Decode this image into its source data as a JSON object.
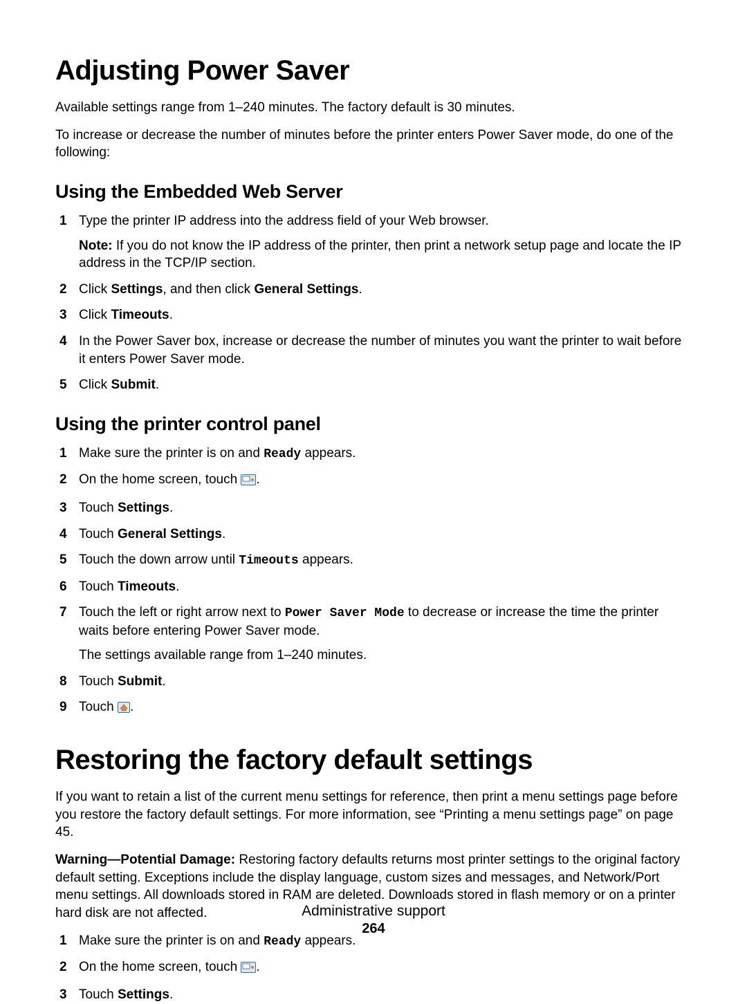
{
  "section1": {
    "title": "Adjusting Power Saver",
    "intro1": "Available settings range from 1–240 minutes. The factory default is 30 minutes.",
    "intro2": "To increase or decrease the number of minutes before the printer enters Power Saver mode, do one of the following:",
    "sub1": {
      "title": "Using the Embedded Web Server",
      "steps": {
        "s1": "Type the printer IP address into the address field of your Web browser.",
        "s1_note_label": "Note:",
        "s1_note_body": " If you do not know the IP address of the printer, then print a network setup page and locate the IP address in the TCP/IP section.",
        "s2_a": "Click ",
        "s2_b": "Settings",
        "s2_c": ", and then click ",
        "s2_d": "General Settings",
        "s2_e": ".",
        "s3_a": "Click ",
        "s3_b": "Timeouts",
        "s3_c": ".",
        "s4": "In the Power Saver box, increase or decrease the number of minutes you want the printer to wait before it enters Power Saver mode.",
        "s5_a": "Click ",
        "s5_b": "Submit",
        "s5_c": "."
      }
    },
    "sub2": {
      "title": "Using the printer control panel",
      "steps": {
        "s1_a": "Make sure the printer is on and ",
        "s1_b": "Ready",
        "s1_c": " appears.",
        "s2_a": "On the home screen, touch ",
        "s2_b": ".",
        "s3_a": "Touch ",
        "s3_b": "Settings",
        "s3_c": ".",
        "s4_a": "Touch ",
        "s4_b": "General Settings",
        "s4_c": ".",
        "s5_a": "Touch the down arrow until ",
        "s5_b": "Timeouts",
        "s5_c": " appears.",
        "s6_a": "Touch ",
        "s6_b": "Timeouts",
        "s6_c": ".",
        "s7_a": "Touch the left or right arrow next to ",
        "s7_b": "Power Saver Mode",
        "s7_c": " to decrease or increase the time the printer waits before entering Power Saver mode.",
        "s7_sub": "The settings available range from 1–240 minutes.",
        "s8_a": "Touch ",
        "s8_b": "Submit",
        "s8_c": ".",
        "s9_a": "Touch ",
        "s9_b": "."
      }
    }
  },
  "section2": {
    "title": "Restoring the factory default settings",
    "p1": "If you want to retain a list of the current menu settings for reference, then print a menu settings page before you restore the factory default settings. For more information, see “Printing a menu settings page” on page 45.",
    "warn_label": "Warning—Potential Damage:",
    "warn_body": " Restoring factory defaults returns most printer settings to the original factory default setting. Exceptions include the display language, custom sizes and messages, and Network/Port menu settings. All downloads stored in RAM are deleted. Downloads stored in flash memory or on a printer hard disk are not affected.",
    "steps": {
      "s1_a": "Make sure the printer is on and ",
      "s1_b": "Ready",
      "s1_c": " appears.",
      "s2_a": "On the home screen, touch ",
      "s2_b": ".",
      "s3_a": "Touch ",
      "s3_b": "Settings",
      "s3_c": "."
    }
  },
  "footer": {
    "label": "Administrative support",
    "page": "264"
  }
}
